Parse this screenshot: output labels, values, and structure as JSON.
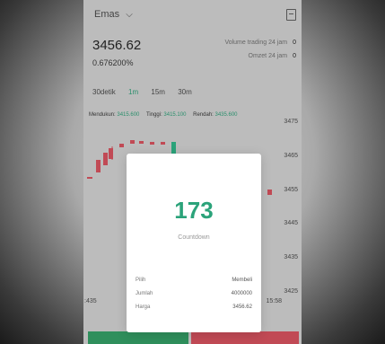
{
  "header": {
    "title": "Emas"
  },
  "ticker": {
    "price": "3456.62",
    "change_pct": "0.676200%",
    "stats": [
      {
        "label": "Volume trading 24 jam",
        "value": "0"
      },
      {
        "label": "Omzet 24 jam",
        "value": "0"
      }
    ]
  },
  "timeframes": [
    {
      "label": "30detik",
      "active": false
    },
    {
      "label": "1m",
      "active": true
    },
    {
      "label": "15m",
      "active": false
    },
    {
      "label": "30m",
      "active": false
    }
  ],
  "indicators": [
    {
      "label": "Mendukun:",
      "value": "3415.600"
    },
    {
      "label": "Tinggi:",
      "value": "3415.100"
    },
    {
      "label": "Rendah:",
      "value": "3435.600"
    }
  ],
  "axis_labels": [
    "3475",
    "3465",
    "3455",
    "3445",
    "3435",
    "3425"
  ],
  "time_labels": [
    ":435",
    "15:58"
  ],
  "modal": {
    "count": "173",
    "label": "Countdown",
    "rows": [
      {
        "label": "Pilih",
        "value": "Membeli"
      },
      {
        "label": "Jumlah",
        "value": "4000000"
      },
      {
        "label": "Harga",
        "value": "3456.62"
      }
    ]
  },
  "colors": {
    "up": "#2ba37a",
    "down": "#c14a55",
    "buy_button": "#2f8f5c",
    "sell_button": "#c14a55"
  }
}
